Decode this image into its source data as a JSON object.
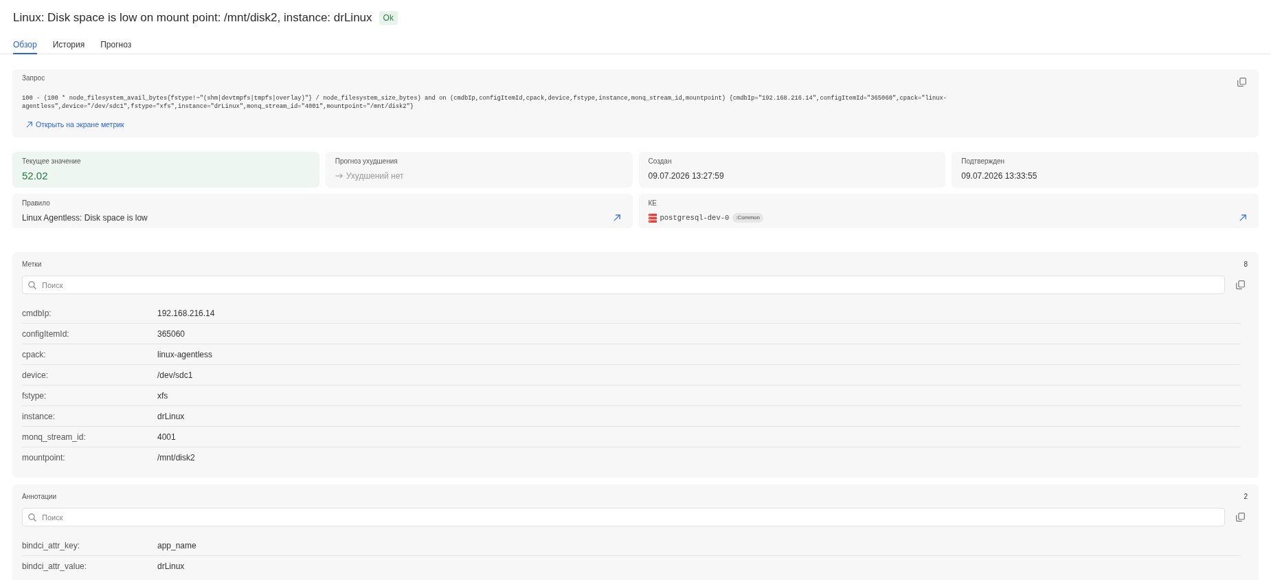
{
  "title": "Linux: Disk space is low on mount point: /mnt/disk2, instance: drLinux",
  "status_badge": "Ok",
  "tabs": [
    {
      "label": "Обзор",
      "selected": true
    },
    {
      "label": "История",
      "selected": false
    },
    {
      "label": "Прогноз",
      "selected": false
    }
  ],
  "query": {
    "label": "Запрос",
    "text": "100 - (100 * node_filesystem_avail_bytes{fstype!~\"(shm|devtmpfs|tmpfs|overlay)\"} / node_filesystem_size_bytes) and on (cmdbIp,configItemId,cpack,device,fstype,instance,monq_stream_id,mountpoint) {cmdbIp=\"192.168.216.14\",configItemId=\"365060\",cpack=\"linux-agentless\",device=\"/dev/sdc1\",fstype=\"xfs\",instance=\"drLinux\",monq_stream_id=\"4001\",mountpoint=\"/mnt/disk2\"}",
    "link": "Открыть на экране метрик"
  },
  "cards": [
    {
      "kind": "current_value",
      "label": "Текущее значение",
      "value": "52.02"
    },
    {
      "kind": "forecast",
      "label": "Прогноз ухудшения",
      "value": "Ухудшений нет"
    },
    {
      "kind": "timestamp",
      "label": "Создан",
      "value": "09.07.2026 13:27:59"
    },
    {
      "kind": "timestamp",
      "label": "Подтвержден",
      "value": "09.07.2026 13:33:55"
    },
    {
      "kind": "rule",
      "label": "Правило",
      "value": "Linux Agentless: Disk space is low"
    },
    {
      "kind": "config_item",
      "label": "КЕ",
      "value": "postgresql-dev-0",
      "tag": ":Common"
    }
  ],
  "labels": {
    "title": "Метки",
    "count": "8",
    "search": {
      "placeholder": "Поиск"
    },
    "rows": [
      {
        "key": "cmdbIp:",
        "value": "192.168.216.14"
      },
      {
        "key": "configItemId:",
        "value": "365060"
      },
      {
        "key": "cpack:",
        "value": "linux-agentless"
      },
      {
        "key": "device:",
        "value": "/dev/sdc1"
      },
      {
        "key": "fstype:",
        "value": "xfs"
      },
      {
        "key": "instance:",
        "value": "drLinux"
      },
      {
        "key": "monq_stream_id:",
        "value": "4001"
      },
      {
        "key": "mountpoint:",
        "value": "/mnt/disk2"
      }
    ]
  },
  "annotations": {
    "title": "Аннотации",
    "count": "2",
    "search": {
      "placeholder": "Поиск"
    },
    "rows": [
      {
        "key": "bindci_attr_key:",
        "value": "app_name"
      },
      {
        "key": "bindci_attr_value:",
        "value": "drLinux"
      }
    ]
  }
}
